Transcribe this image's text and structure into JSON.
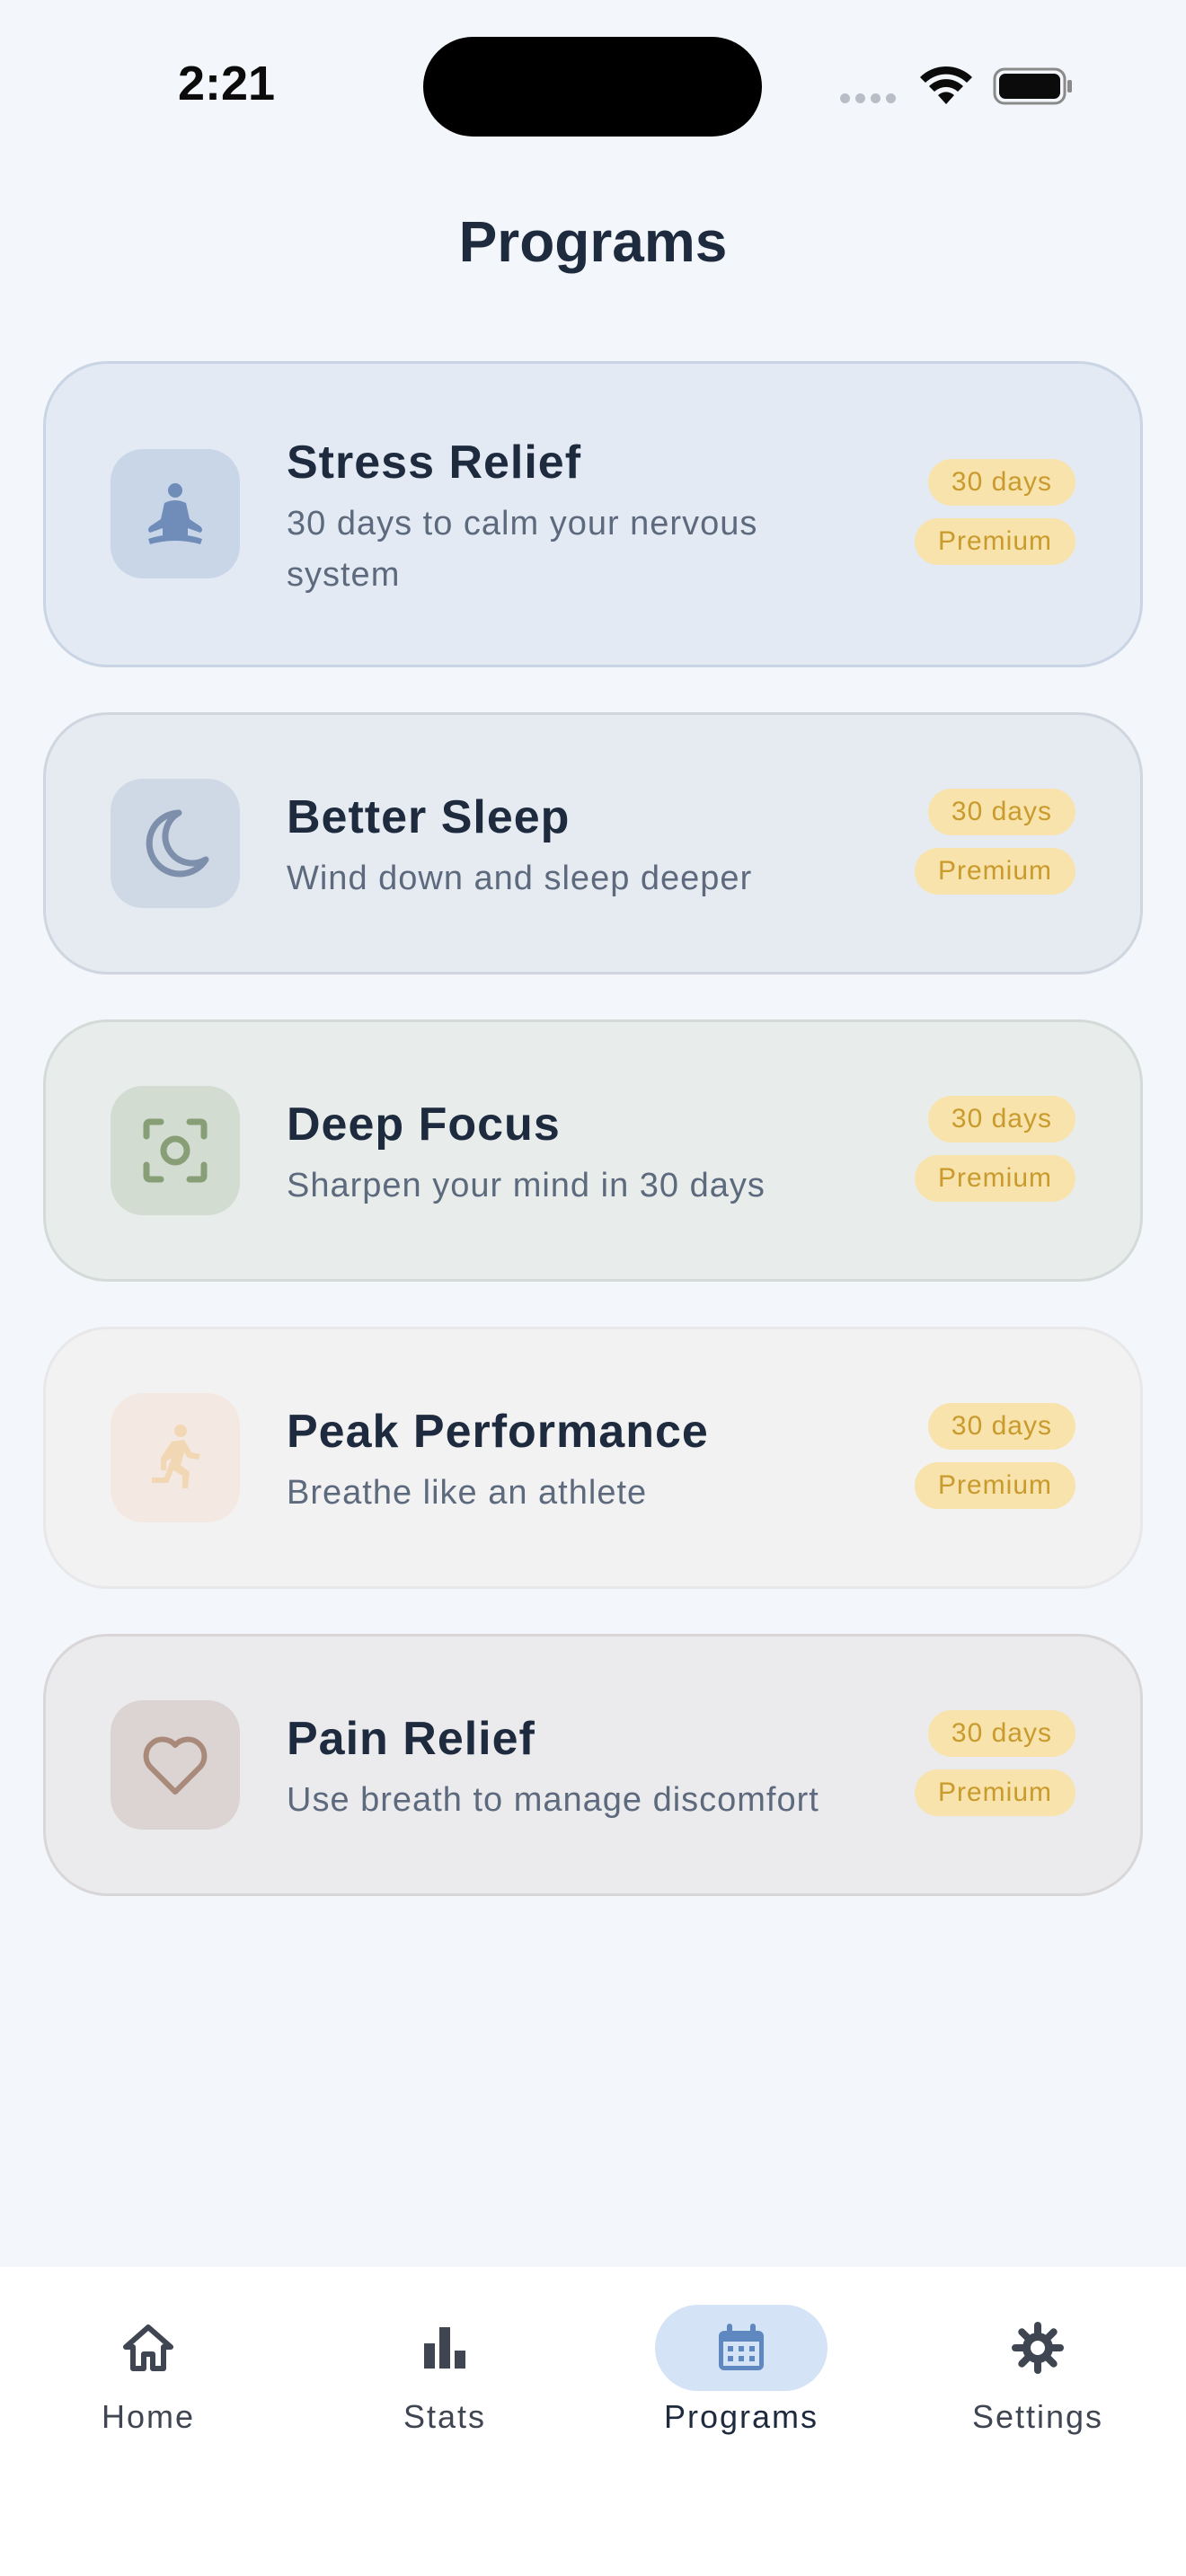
{
  "status_bar": {
    "time": "2:21"
  },
  "page": {
    "title": "Programs"
  },
  "programs": [
    {
      "title": "Stress Relief",
      "description": "30 days to calm your nervous system",
      "duration_badge": "30 days",
      "tier_badge": "Premium",
      "icon": "meditation-icon"
    },
    {
      "title": "Better Sleep",
      "description": "Wind down and sleep deeper",
      "duration_badge": "30 days",
      "tier_badge": "Premium",
      "icon": "moon-icon"
    },
    {
      "title": "Deep Focus",
      "description": "Sharpen your mind in 30 days",
      "duration_badge": "30 days",
      "tier_badge": "Premium",
      "icon": "focus-icon"
    },
    {
      "title": "Peak Performance",
      "description": "Breathe like an athlete",
      "duration_badge": "30 days",
      "tier_badge": "Premium",
      "icon": "running-icon"
    },
    {
      "title": "Pain Relief",
      "description": "Use breath to manage discomfort",
      "duration_badge": "30 days",
      "tier_badge": "Premium",
      "icon": "heart-icon"
    }
  ],
  "tab_bar": {
    "active": "Programs",
    "tabs": [
      {
        "label": "Home",
        "icon": "home-icon"
      },
      {
        "label": "Stats",
        "icon": "bar-chart-icon"
      },
      {
        "label": "Programs",
        "icon": "calendar-icon"
      },
      {
        "label": "Settings",
        "icon": "gear-icon"
      }
    ]
  },
  "colors": {
    "background": "#f3f6fa",
    "badge_bg": "#f8e3ac",
    "badge_text": "#c99a2c",
    "active_tab_pill": "#d4e3f5",
    "title_text": "#1e2a3d"
  }
}
